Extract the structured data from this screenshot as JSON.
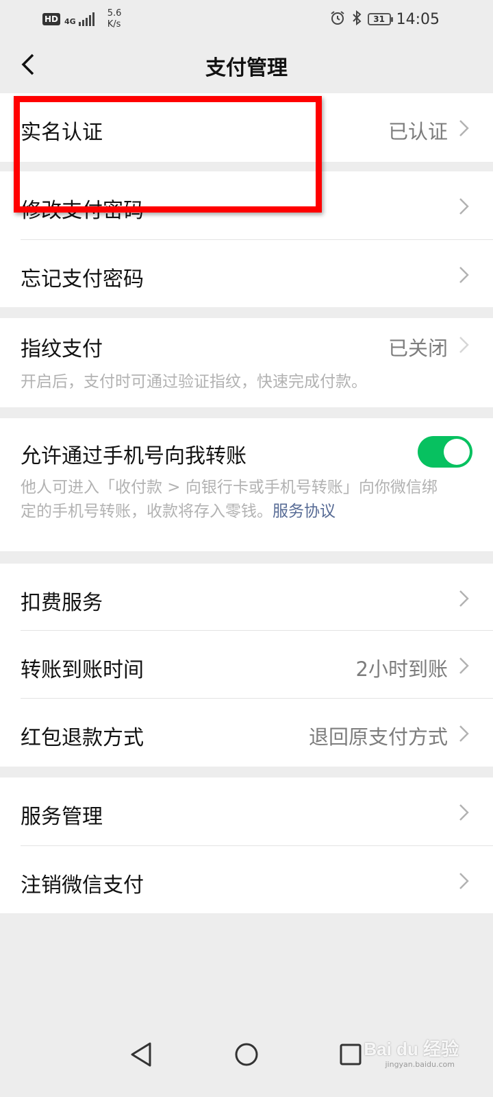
{
  "status_bar": {
    "hd": "HD",
    "signal": "4G",
    "speed_value": "5.6",
    "speed_unit": "K/s",
    "battery": "31",
    "time": "14:05"
  },
  "header": {
    "title": "支付管理"
  },
  "rows": {
    "real_name": {
      "label": "实名认证",
      "value": "已认证"
    },
    "change_password": {
      "label": "修改支付密码"
    },
    "forgot_password": {
      "label": "忘记支付密码"
    },
    "fingerprint": {
      "label": "指纹支付",
      "value": "已关闭",
      "desc": "开启后，支付时可通过验证指纹，快速完成付款。"
    },
    "phone_transfer": {
      "label": "允许通过手机号向我转账",
      "toggle_on": true,
      "desc_line1": "他人可进入「收付款 > 向银行卡或手机号转账」向你微信绑",
      "desc_line2": "定的手机号转账，收款将存入零钱。",
      "link": "服务协议"
    },
    "deduction": {
      "label": "扣费服务"
    },
    "transfer_time": {
      "label": "转账到账时间",
      "value": "2小时到账"
    },
    "red_packet_refund": {
      "label": "红包退款方式",
      "value": "退回原支付方式"
    },
    "service_manage": {
      "label": "服务管理"
    },
    "cancel_pay": {
      "label": "注销微信支付"
    }
  },
  "watermark": {
    "brand": "Bai du 经验",
    "url": "jingyan.baidu.com"
  },
  "colors": {
    "accent_green": "#07c160",
    "link": "#576b95",
    "highlight": "#ff0000"
  }
}
